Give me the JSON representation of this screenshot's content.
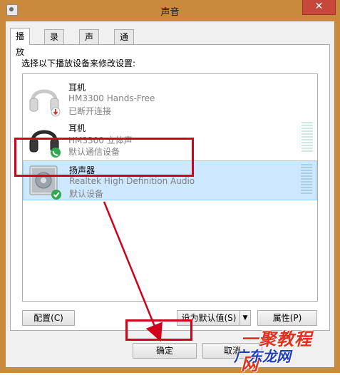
{
  "window": {
    "title": "声音",
    "close_label": "✕"
  },
  "tabs": [
    {
      "label": "播放",
      "active": true
    },
    {
      "label": "录制",
      "active": false
    },
    {
      "label": "声音",
      "active": false
    },
    {
      "label": "通信",
      "active": false
    }
  ],
  "panel": {
    "instruction": "选择以下播放设备来修改设置:"
  },
  "devices": [
    {
      "name": "耳机",
      "description": "HM3300 Hands-Free",
      "status": "已断开连接",
      "icon": "headphones-disconnected-icon",
      "selected": false
    },
    {
      "name": "耳机",
      "description": "HM3300 立体声",
      "status": "默认通信设备",
      "icon": "headphones-communication-icon",
      "selected": false
    },
    {
      "name": "扬声器",
      "description": "Realtek High Definition Audio",
      "status": "默认设备",
      "icon": "speaker-default-icon",
      "selected": true
    }
  ],
  "buttons": {
    "configure": "配置(C)",
    "set_default": "设为默认值(S)",
    "properties": "属性(P)",
    "ok": "确定",
    "cancel": "取消"
  },
  "watermark": {
    "main": "一聚教程网",
    "sub": "广东龙网"
  },
  "colors": {
    "highlight": "#d0021b",
    "selection": "#cde8ff",
    "titlebar": "#ca8a3e"
  }
}
